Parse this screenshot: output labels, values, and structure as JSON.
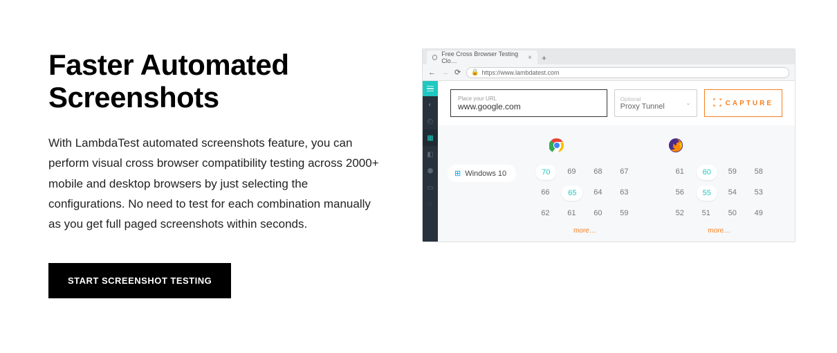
{
  "heading": "Faster Automated Screenshots",
  "body": "With LambdaTest automated screenshots feature, you can perform visual cross browser compatibility testing across 2000+ mobile and desktop browsers by just selecting the configurations. No need to test for each combination manually as you get full paged screenshots within seconds.",
  "cta": "START SCREENSHOT TESTING",
  "browser": {
    "tab_title": "Free Cross Browser Testing Clo…",
    "new_tab": "+",
    "address": "https://www.lambdatest.com"
  },
  "form": {
    "url_placeholder": "Place your URL",
    "url_value": "www.google.com",
    "proxy_label": "Optional",
    "proxy_value": "Proxy Tunnel",
    "capture": "CAPTURE"
  },
  "os": {
    "name": "Windows 10"
  },
  "chrome": {
    "versions": [
      "70",
      "69",
      "68",
      "67",
      "66",
      "65",
      "64",
      "63",
      "62",
      "61",
      "60",
      "59"
    ],
    "selected": [
      "70",
      "65"
    ],
    "more": "more…"
  },
  "firefox": {
    "versions": [
      "61",
      "60",
      "59",
      "58",
      "56",
      "55",
      "54",
      "53",
      "52",
      "51",
      "50",
      "49"
    ],
    "selected": [
      "60",
      "55"
    ],
    "more": "more…"
  }
}
